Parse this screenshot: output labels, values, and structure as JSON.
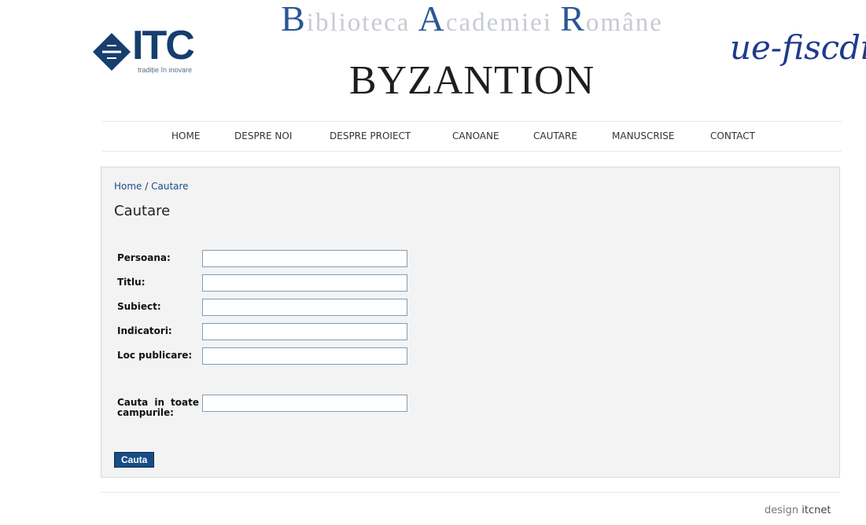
{
  "header": {
    "itc_logo_text": "ITC",
    "itc_tagline": "tradiție în inovare",
    "library_title": {
      "word1_cap": "B",
      "word1_rest": "iblioteca",
      "word2_cap": "A",
      "word2_rest": "cademiei",
      "word3_cap": "R",
      "word3_rest": "omâne"
    },
    "site_title": "BYZANTION",
    "partner_logo_text": "ue-fiscdi"
  },
  "nav": {
    "items": [
      {
        "label": "HOME"
      },
      {
        "label": "DESPRE NOI"
      },
      {
        "label": "DESPRE PROIECT"
      },
      {
        "label": "CANOANE"
      },
      {
        "label": "CAUTARE"
      },
      {
        "label": "MANUSCRISE"
      },
      {
        "label": "CONTACT"
      }
    ]
  },
  "breadcrumb": {
    "home": "Home",
    "separator": " / ",
    "current": "Cautare"
  },
  "page_title": "Cautare",
  "form": {
    "fields": [
      {
        "label": "Persoana:",
        "value": ""
      },
      {
        "label": "Titlu:",
        "value": ""
      },
      {
        "label": "Subiect:",
        "value": ""
      },
      {
        "label": "Indicatori:",
        "value": ""
      },
      {
        "label": "Loc publicare:",
        "value": ""
      },
      {
        "label": "Cauta in toate campurile:",
        "value": ""
      }
    ],
    "submit_label": "Cauta"
  },
  "footer": {
    "design_prefix": "design",
    "design_brand": "itcnet"
  },
  "colors": {
    "brand_blue": "#184c85",
    "title_cap_blue": "#2a5795",
    "panel_bg": "#f3f3f3",
    "input_border": "#7f9db9"
  }
}
